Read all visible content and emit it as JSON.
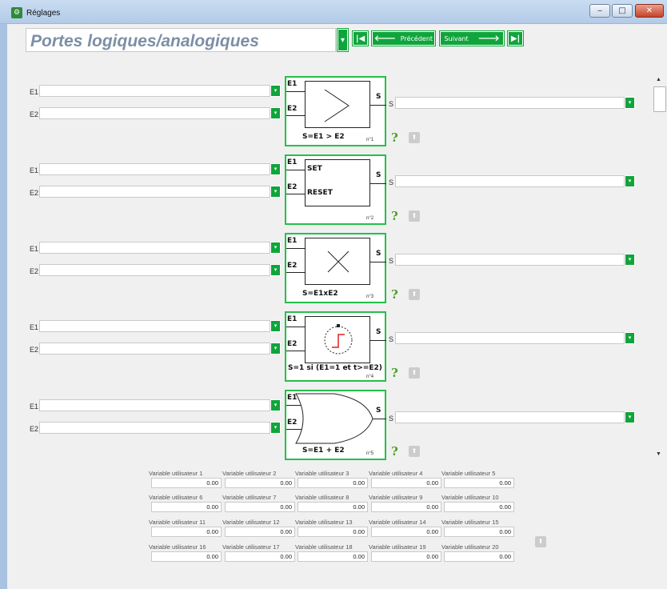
{
  "window": {
    "title": "Réglages",
    "app_icon_glyph": "⚙",
    "buttons": {
      "minimize": "‒",
      "maximize": "□",
      "close": "✕"
    }
  },
  "header": {
    "title": "Portes logiques/analogiques",
    "previous_label": "Précédent",
    "next_label": "Suivant"
  },
  "gates": [
    {
      "in1": "E1",
      "in2": "E2",
      "out": "S",
      "pin1": "E1",
      "pin2": "E2",
      "pin_out": "S",
      "formula": "S=E1 > E2",
      "number": "n°1",
      "icon": "greater-than"
    },
    {
      "in1": "E1",
      "in2": "E2",
      "out": "S",
      "pin1": "E1",
      "pin2": "E2",
      "pin_out": "S",
      "formula": "",
      "number": "n°2",
      "icon": "set-reset",
      "set_label": "SET",
      "reset_label": "RESET"
    },
    {
      "in1": "E1",
      "in2": "E2",
      "out": "S",
      "pin1": "E1",
      "pin2": "E2",
      "pin_out": "S",
      "formula": "S=E1xE2",
      "number": "n°3",
      "icon": "multiply"
    },
    {
      "in1": "E1",
      "in2": "E2",
      "out": "S",
      "pin1": "E1",
      "pin2": "E2",
      "pin_out": "S",
      "formula": "S=1 si (E1=1 et t>=E2)",
      "number": "n°4",
      "icon": "timer"
    },
    {
      "in1": "E1",
      "in2": "E2",
      "out": "S",
      "pin1": "E1",
      "pin2": "E2",
      "pin_out": "S",
      "formula": "S=E1 + E2",
      "number": "n°5",
      "icon": "or-gate"
    }
  ],
  "help_glyph": "?",
  "upload_glyph": "⬆",
  "user_variables": [
    {
      "label": "Variable utilisateur 1",
      "value": "0.00"
    },
    {
      "label": "Variable utilisateur 2",
      "value": "0.00"
    },
    {
      "label": "Variable utilisateur 3",
      "value": "0.00"
    },
    {
      "label": "Variable utilisateur 4",
      "value": "0.00"
    },
    {
      "label": "Variable utilisateur 5",
      "value": "0.00"
    },
    {
      "label": "Variable utilisateur 6",
      "value": "0.00"
    },
    {
      "label": "Variable utilisateur 7",
      "value": "0.00"
    },
    {
      "label": "Variable utilisateur 8",
      "value": "0.00"
    },
    {
      "label": "Variable utilisateur 9",
      "value": "0.00"
    },
    {
      "label": "Variable utilisateur 10",
      "value": "0.00"
    },
    {
      "label": "Variable utilisateur 11",
      "value": "0.00"
    },
    {
      "label": "Variable utilisateur 12",
      "value": "0.00"
    },
    {
      "label": "Variable utilisateur 13",
      "value": "0.00"
    },
    {
      "label": "Variable utilisateur 14",
      "value": "0.00"
    },
    {
      "label": "Variable utilisateur 15",
      "value": "0.00"
    },
    {
      "label": "Variable utilisateur 16",
      "value": "0.00"
    },
    {
      "label": "Variable utilisateur 17",
      "value": "0.00"
    },
    {
      "label": "Variable utilisateur 18",
      "value": "0.00"
    },
    {
      "label": "Variable utilisateur 19",
      "value": "0.00"
    },
    {
      "label": "Variable utilisateur 20",
      "value": "0.00"
    }
  ],
  "colors": {
    "accent": "#10a53c",
    "gate_border": "#25c04a",
    "help": "#4aa024",
    "title_text": "#7c8fa6"
  }
}
